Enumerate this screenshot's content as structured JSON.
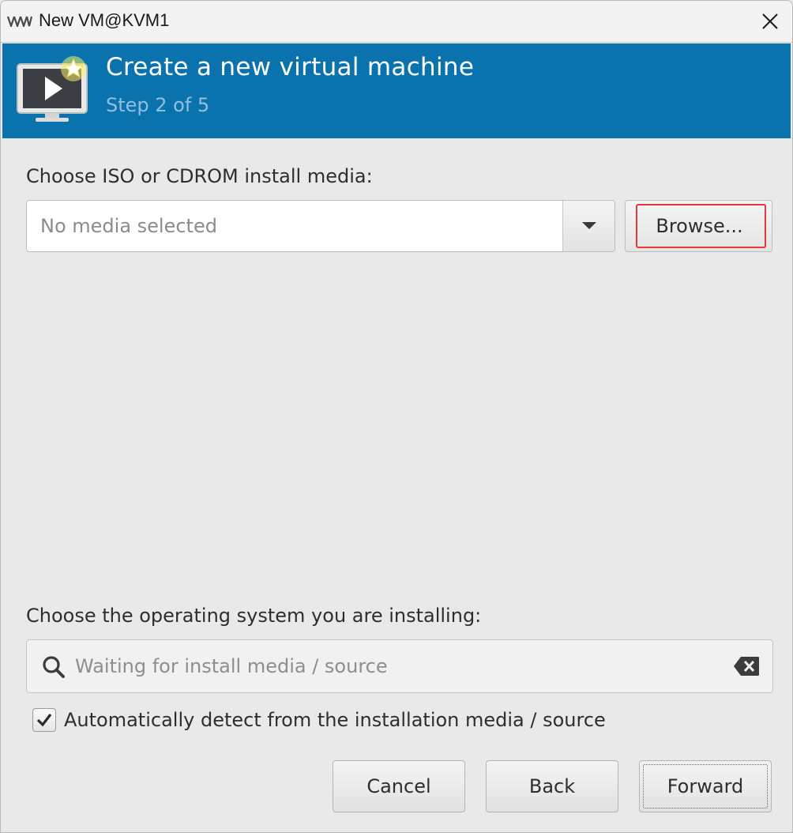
{
  "window": {
    "title": "New VM@KVM1"
  },
  "banner": {
    "title": "Create a new virtual machine",
    "step": "Step 2 of 5",
    "color": "#0a73ae"
  },
  "media": {
    "label": "Choose ISO or CDROM install media:",
    "value": "",
    "placeholder": "No media selected",
    "browse_label": "Browse...",
    "highlight_color": "#e23a3a"
  },
  "os": {
    "label": "Choose the operating system you are installing:",
    "value": "",
    "placeholder": "Waiting for install media / source",
    "search_icon": "search-icon",
    "clear_icon": "clear-icon"
  },
  "auto_detect": {
    "label": "Automatically detect from the installation media / source",
    "checked": true
  },
  "buttons": {
    "cancel": "Cancel",
    "back": "Back",
    "forward": "Forward"
  }
}
